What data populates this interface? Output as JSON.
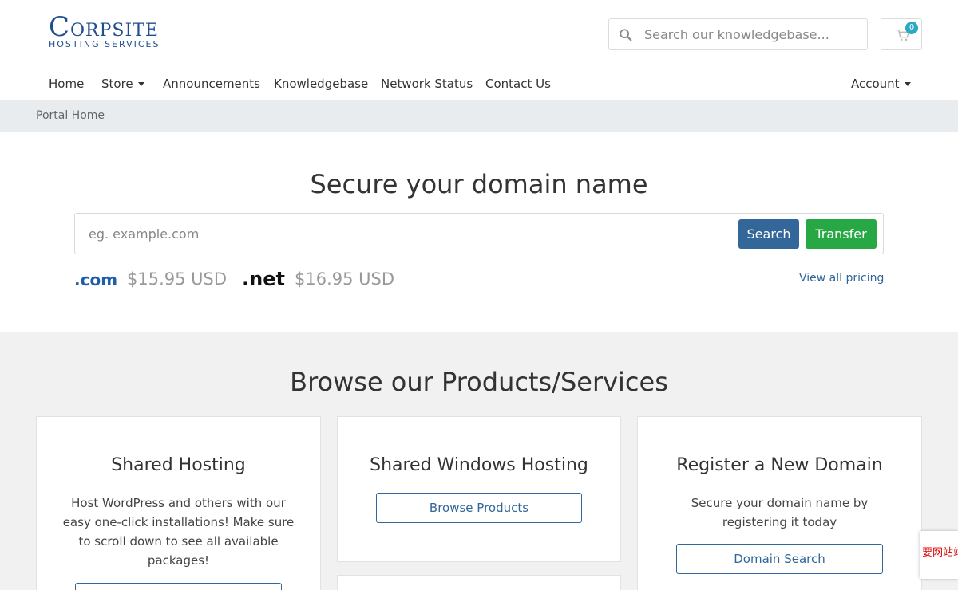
{
  "brand": {
    "name_first": "C",
    "name_rest": "ORPSITE",
    "tagline": "HOSTING SERVICES",
    "color": "#1f4e8c"
  },
  "header": {
    "kb_search_placeholder": "Search our knowledgebase...",
    "cart_count": "0"
  },
  "nav": {
    "items": [
      "Home",
      "Store",
      "Announcements",
      "Knowledgebase",
      "Network Status",
      "Contact Us"
    ],
    "account": "Account"
  },
  "breadcrumb": {
    "home": "Portal Home"
  },
  "domain": {
    "title": "Secure your domain name",
    "placeholder": "eg. example.com",
    "search_label": "Search",
    "transfer_label": "Transfer",
    "tlds": [
      {
        "tld": ".com",
        "price": "$15.95 USD"
      },
      {
        "tld": ".net",
        "price": "$16.95 USD"
      }
    ],
    "view_all": "View all pricing"
  },
  "products": {
    "title": "Browse our Products/Services",
    "cards": [
      {
        "title": "Shared Hosting",
        "description": "Host WordPress and others with our easy one-click installations! Make sure to scroll down to see all available packages!"
      },
      {
        "title": "Shared Windows Hosting",
        "button": "Browse Products"
      },
      {
        "title": "Register a New Domain",
        "description": "Secure your domain name by registering it today",
        "button": "Domain Search"
      }
    ]
  },
  "colors": {
    "primary": "#336699",
    "success": "#28a745",
    "badge": "#2aa8c4",
    "breadcrumb_bg": "#e9ecef",
    "section_bg": "#f1f1f1"
  },
  "captcha_text": "要网站站密钥"
}
